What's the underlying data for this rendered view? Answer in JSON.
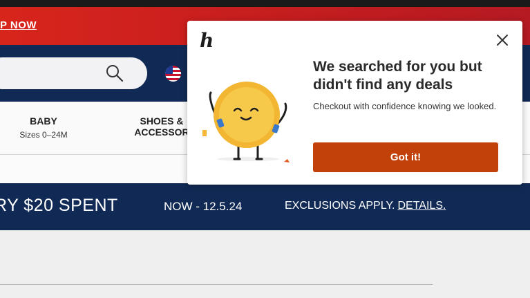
{
  "promo": {
    "link_text": "P NOW"
  },
  "nav": {
    "search_icon": "search-icon",
    "flag_icon": "us-flag-icon"
  },
  "categories": [
    {
      "title": "BABY",
      "subtitle": "Sizes 0–24M"
    },
    {
      "title": "SHOES &",
      "title2": "ACCESSOR"
    }
  ],
  "sale": {
    "main_text": "RY $20 SPENT",
    "date_text": "NOW - 12.5.24",
    "exclusions_text": "EXCLUSIONS APPLY.",
    "details_link": "DETAILS."
  },
  "popup": {
    "logo_text": "h",
    "title": "We searched for you but didn't find any deals",
    "message": "Checkout with confidence knowing we looked.",
    "button_label": "Got it!",
    "close_icon": "close-icon",
    "button_color": "#c2410a",
    "mascot": "coin-mascot-illustration"
  },
  "colors": {
    "navy": "#112a55",
    "red": "#d8251c"
  }
}
